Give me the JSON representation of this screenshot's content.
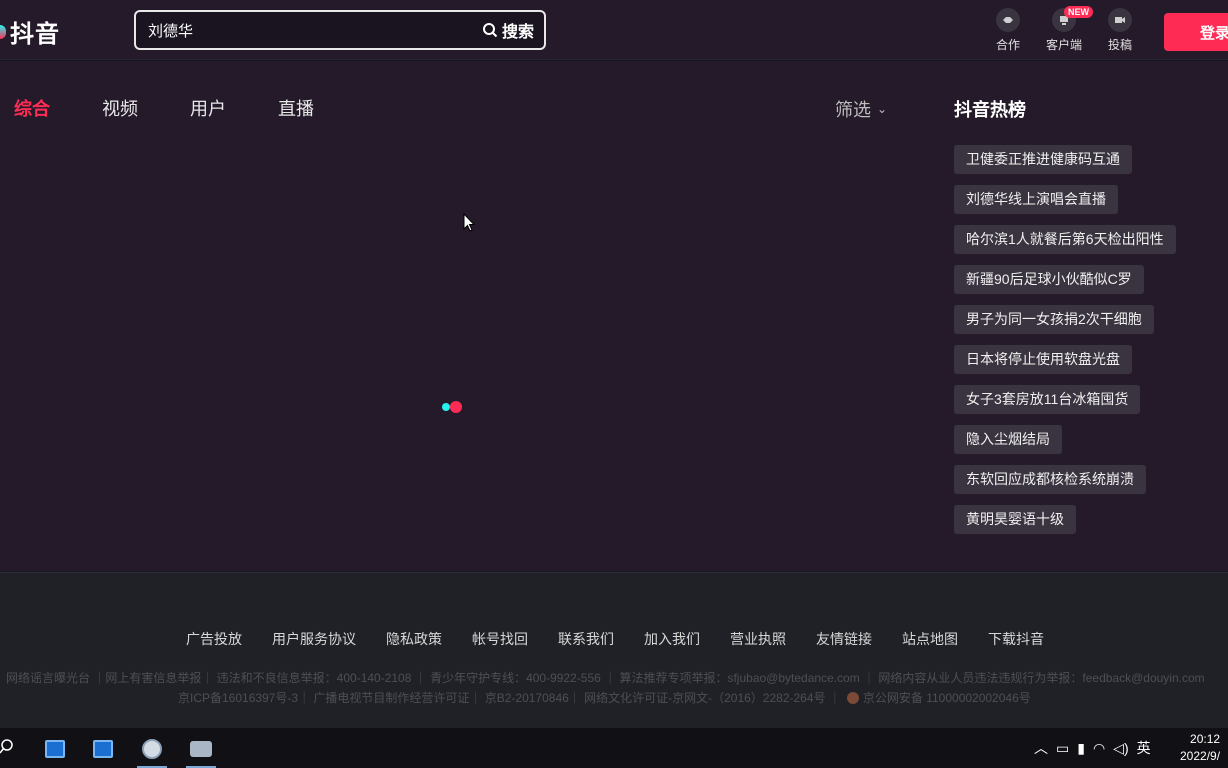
{
  "header": {
    "logo_text": "抖音",
    "search_value": "刘德华",
    "search_button": "搜索",
    "actions": [
      {
        "label": "合作",
        "icon": "handshake-icon"
      },
      {
        "label": "客户端",
        "icon": "client-icon",
        "badge": "NEW"
      },
      {
        "label": "投稿",
        "icon": "upload-video-icon"
      }
    ],
    "login_label": "登录"
  },
  "tabs": [
    {
      "label": "综合",
      "active": true
    },
    {
      "label": "视频",
      "active": false
    },
    {
      "label": "用户",
      "active": false
    },
    {
      "label": "直播",
      "active": false
    }
  ],
  "filter_label": "筛选",
  "hot": {
    "title": "抖音热榜",
    "items": [
      "卫健委正推进健康码互通",
      "刘德华线上演唱会直播",
      "哈尔滨1人就餐后第6天检出阳性",
      "新疆90后足球小伙酷似C罗",
      "男子为同一女孩捐2次干细胞",
      "日本将停止使用软盘光盘",
      "女子3套房放11台冰箱囤货",
      "隐入尘烟结局",
      "东软回应成都核检系统崩溃",
      "黄明昊婴语十级"
    ]
  },
  "footer": {
    "links": [
      "广告投放",
      "用户服务协议",
      "隐私政策",
      "帐号找回",
      "联系我们",
      "加入我们",
      "营业执照",
      "友情链接",
      "站点地图",
      "下载抖音"
    ],
    "line1": "网络谣言曝光台 ｜网上有害信息举报｜ 违法和不良信息举报：400-140-2108 ｜ 青少年守护专线：400-9922-556 ｜ 算法推荐专项举报：sfjubao@bytedance.com ｜ 网络内容从业人员违法违规行为举报：feedback@douyin.com",
    "line2": "京ICP备16016397号-3｜ 广播电视节目制作经营许可证｜ 京B2-20170846｜ 网络文化许可证-京网文-（2016）2282-264号 ｜",
    "police": "京公网安备 11000002002046号"
  },
  "taskbar": {
    "tray_lang": "英",
    "time": "20:12",
    "date": "2022/9/"
  },
  "colors": {
    "accent": "#fe2c55",
    "background": "#241a2a",
    "chip": "#3a3340"
  }
}
